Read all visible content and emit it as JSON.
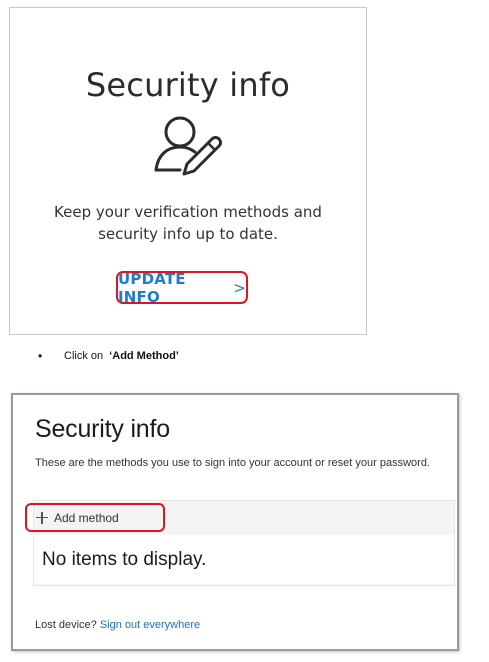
{
  "card1": {
    "title": "Security info",
    "description": "Keep your verification methods and security info up to date.",
    "update_button_label": "UPDATE INFO",
    "update_button_chevron": ">",
    "icon": "user-edit-icon",
    "highlight_color": "#e0141e",
    "link_color": "#1f7ad1"
  },
  "instruction": {
    "bullet": "•",
    "prefix": "Click on ",
    "emphasis": "‘Add Method’"
  },
  "security_page": {
    "title": "Security info",
    "subtitle": "These are the methods you use to sign into your account or reset your password.",
    "add_method_label": "Add method",
    "add_method_icon": "plus-icon",
    "empty_message": "No items to display.",
    "lost_device_prefix": "Lost device?",
    "signout_link_label": "Sign out everywhere"
  }
}
